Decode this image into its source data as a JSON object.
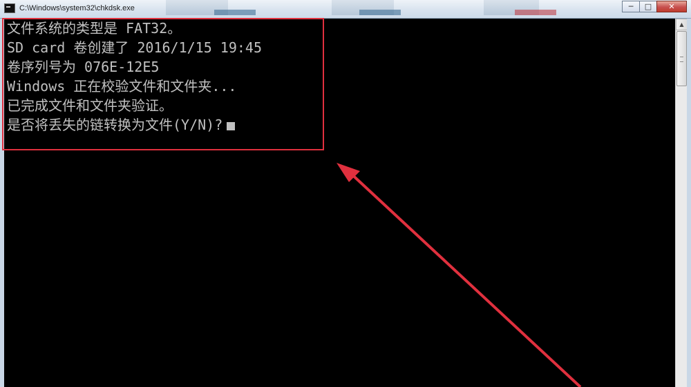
{
  "window": {
    "title": "C:\\Windows\\system32\\chkdsk.exe",
    "controls": {
      "minimize_icon": "minimize-icon",
      "maximize_icon": "maximize-icon",
      "close_icon": "close-icon"
    }
  },
  "console": {
    "lines": [
      "文件系统的类型是 FAT32。",
      "SD card 卷创建了 2016/1/15 19:45",
      "卷序列号为 076E-12E5",
      "Windows 正在校验文件和文件夹...",
      "已完成文件和文件夹验证。",
      "是否将丢失的链转换为文件(Y/N)?"
    ],
    "text_color": "#c0c0c0",
    "background": "#000000"
  },
  "annotation": {
    "color": "#e0303e"
  }
}
